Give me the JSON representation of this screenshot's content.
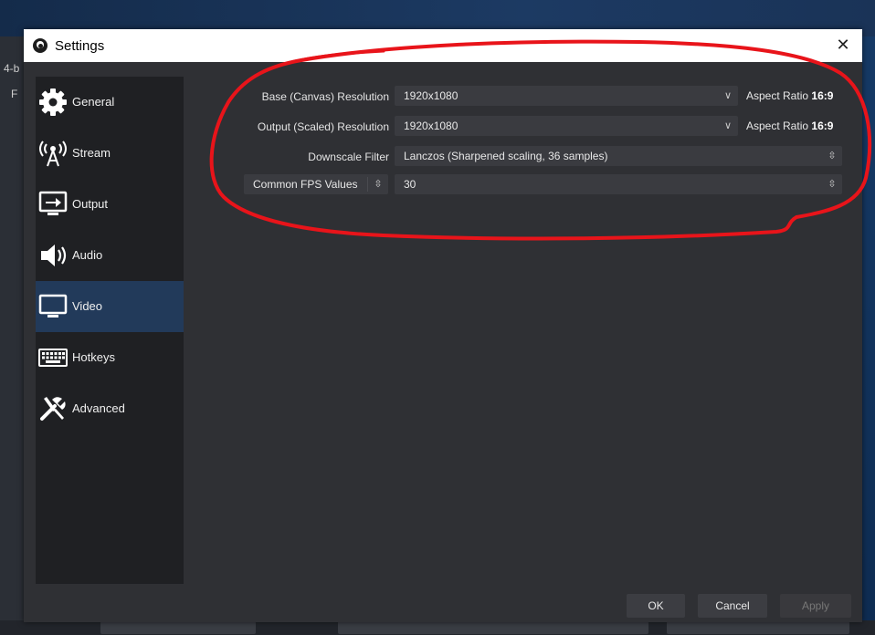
{
  "background": {
    "left_fragment_1": "4-b",
    "left_fragment_2": "F"
  },
  "window": {
    "title": "Settings",
    "close_glyph": "✕",
    "app_icon": "obs-logo-icon"
  },
  "sidebar": {
    "items": [
      {
        "label": "General",
        "icon": "gear-icon"
      },
      {
        "label": "Stream",
        "icon": "broadcast-antenna-icon"
      },
      {
        "label": "Output",
        "icon": "output-monitor-icon"
      },
      {
        "label": "Audio",
        "icon": "speaker-icon"
      },
      {
        "label": "Video",
        "icon": "monitor-icon",
        "selected": true
      },
      {
        "label": "Hotkeys",
        "icon": "keyboard-icon"
      },
      {
        "label": "Advanced",
        "icon": "wrench-screwdriver-icon"
      }
    ]
  },
  "video": {
    "base_resolution": {
      "label": "Base (Canvas) Resolution",
      "value": "1920x1080",
      "aspect_label": "Aspect Ratio",
      "aspect_value": "16:9"
    },
    "output_resolution": {
      "label": "Output (Scaled) Resolution",
      "value": "1920x1080",
      "aspect_label": "Aspect Ratio",
      "aspect_value": "16:9"
    },
    "downscale_filter": {
      "label": "Downscale Filter",
      "value": "Lanczos (Sharpened scaling, 36 samples)"
    },
    "fps": {
      "type_value": "Common FPS Values",
      "value": "30"
    }
  },
  "buttons": {
    "ok": "OK",
    "cancel": "Cancel",
    "apply": "Apply"
  },
  "colors": {
    "dialog_bg": "#2f3034",
    "sidebar_bg": "#1f2023",
    "selected_bg": "#223a5a",
    "annotation": "#e8141a"
  }
}
